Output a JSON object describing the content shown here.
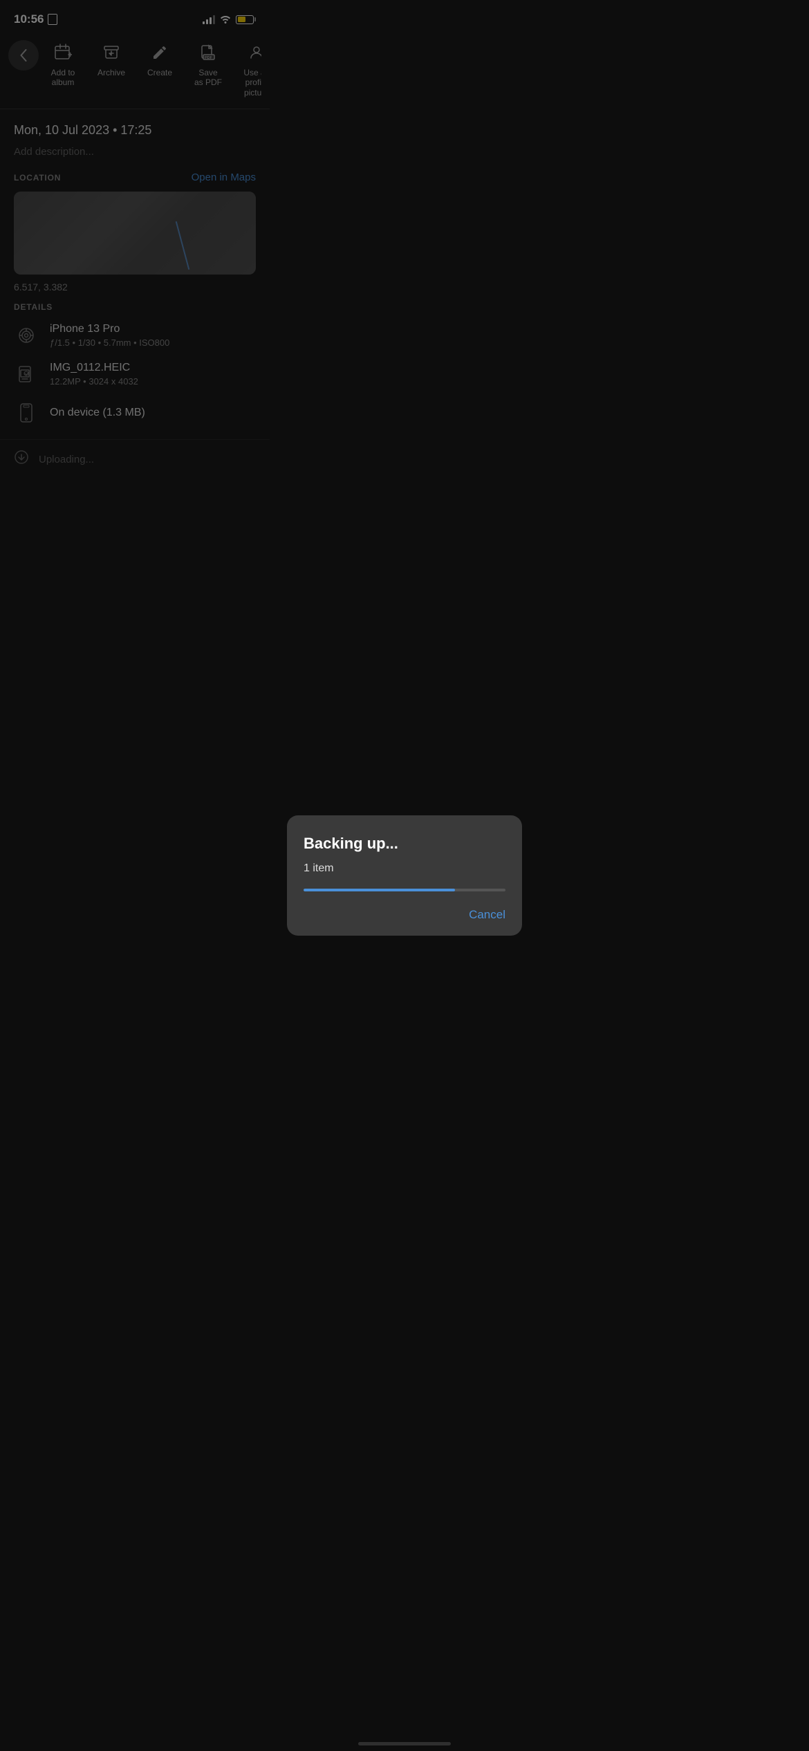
{
  "statusBar": {
    "time": "10:56",
    "batteryColor": "#ffd60a"
  },
  "toolbar": {
    "backLabel": "‹",
    "items": [
      {
        "id": "add-to-album",
        "label": "Add to\nalbum",
        "icon": "⊞"
      },
      {
        "id": "archive",
        "label": "Archive",
        "icon": "⬇"
      },
      {
        "id": "create",
        "label": "Create",
        "icon": "✏"
      },
      {
        "id": "save-as-pdf",
        "label": "Save as PDF",
        "icon": "📄"
      },
      {
        "id": "use-as-profile",
        "label": "Use as\nprofile\npicture",
        "icon": "👤"
      }
    ]
  },
  "photoInfo": {
    "date": "Mon, 10 Jul 2023  •  17:25",
    "descriptionPlaceholder": "Add description..."
  },
  "location": {
    "label": "LOCATION",
    "openInMaps": "Open in Maps",
    "coordinates": "6.517, 3.382"
  },
  "details": {
    "label": "DETAILS",
    "camera": {
      "title": "iPhone 13 Pro",
      "subtitle": "ƒ/1.5  •  1/30  •  5.7mm  •  ISO800"
    },
    "file": {
      "title": "IMG_0112.HEIC",
      "subtitle": "12.2MP  •  3024 x 4032"
    },
    "storage": {
      "title": "On device (1.3 MB)"
    }
  },
  "uploadStatus": {
    "text": "Uploading..."
  },
  "modal": {
    "title": "Backing up...",
    "subtitle": "1 item",
    "progressPercent": 75,
    "cancelLabel": "Cancel"
  }
}
